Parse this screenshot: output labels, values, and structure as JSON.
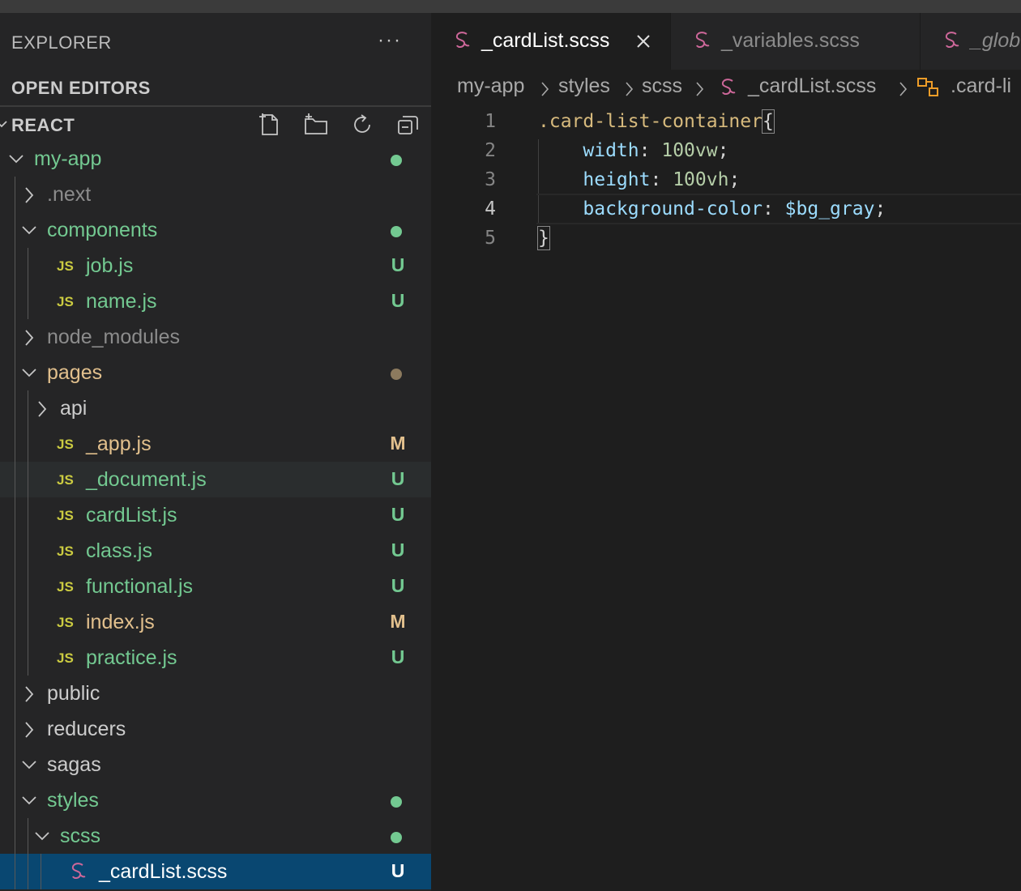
{
  "explorer": {
    "title": "EXPLORER",
    "more_label": "···",
    "open_editors_label": "OPEN EDITORS",
    "workspace_label": "REACT"
  },
  "tree": [
    {
      "name": "my-app",
      "type": "folder",
      "expanded": true,
      "depth": 0,
      "color": "#73c991",
      "status": "dot",
      "dot_color": "#73c991"
    },
    {
      "name": ".next",
      "type": "folder",
      "expanded": false,
      "depth": 1,
      "color": "#8c8c8c"
    },
    {
      "name": "components",
      "type": "folder",
      "expanded": true,
      "depth": 1,
      "color": "#73c991",
      "status": "dot",
      "dot_color": "#73c991"
    },
    {
      "name": "job.js",
      "type": "js",
      "depth": 2,
      "color": "#73c991",
      "status": "U",
      "status_color": "#73c991"
    },
    {
      "name": "name.js",
      "type": "js",
      "depth": 2,
      "color": "#73c991",
      "status": "U",
      "status_color": "#73c991"
    },
    {
      "name": "node_modules",
      "type": "folder",
      "expanded": false,
      "depth": 1,
      "color": "#8c8c8c"
    },
    {
      "name": "pages",
      "type": "folder",
      "expanded": true,
      "depth": 1,
      "color": "#e2c08d",
      "status": "dot",
      "dot_color": "#8c7a5e"
    },
    {
      "name": "api",
      "type": "folder",
      "expanded": false,
      "depth": 2,
      "color": "#cccccc"
    },
    {
      "name": "_app.js",
      "type": "js",
      "depth": 2,
      "color": "#e2c08d",
      "status": "M",
      "status_color": "#e2c08d"
    },
    {
      "name": "_document.js",
      "type": "js",
      "depth": 2,
      "color": "#73c991",
      "status": "U",
      "status_color": "#73c991",
      "hover": true
    },
    {
      "name": "cardList.js",
      "type": "js",
      "depth": 2,
      "color": "#73c991",
      "status": "U",
      "status_color": "#73c991"
    },
    {
      "name": "class.js",
      "type": "js",
      "depth": 2,
      "color": "#73c991",
      "status": "U",
      "status_color": "#73c991"
    },
    {
      "name": "functional.js",
      "type": "js",
      "depth": 2,
      "color": "#73c991",
      "status": "U",
      "status_color": "#73c991"
    },
    {
      "name": "index.js",
      "type": "js",
      "depth": 2,
      "color": "#e2c08d",
      "status": "M",
      "status_color": "#e2c08d"
    },
    {
      "name": "practice.js",
      "type": "js",
      "depth": 2,
      "color": "#73c991",
      "status": "U",
      "status_color": "#73c991"
    },
    {
      "name": "public",
      "type": "folder",
      "expanded": false,
      "depth": 1,
      "color": "#cccccc"
    },
    {
      "name": "reducers",
      "type": "folder",
      "expanded": false,
      "depth": 1,
      "color": "#cccccc"
    },
    {
      "name": "sagas",
      "type": "folder",
      "expanded": true,
      "depth": 1,
      "color": "#cccccc"
    },
    {
      "name": "styles",
      "type": "folder",
      "expanded": true,
      "depth": 1,
      "color": "#73c991",
      "status": "dot",
      "dot_color": "#73c991"
    },
    {
      "name": "scss",
      "type": "folder",
      "expanded": true,
      "depth": 2,
      "color": "#73c991",
      "status": "dot",
      "dot_color": "#73c991"
    },
    {
      "name": "_cardList.scss",
      "type": "scss",
      "depth": 3,
      "color": "#ffffff",
      "status": "U",
      "status_color": "#ffffff",
      "selected": true
    }
  ],
  "tabs": [
    {
      "label": "_cardList.scss",
      "active": true
    },
    {
      "label": "_variables.scss",
      "active": false
    },
    {
      "label": "_glob",
      "active": false
    }
  ],
  "breadcrumb": {
    "items": [
      "my-app",
      "styles",
      "scss",
      "_cardList.scss",
      ".card-li"
    ]
  },
  "code": {
    "line_numbers": [
      "1",
      "2",
      "3",
      "4",
      "5"
    ],
    "active_line": 4,
    "selector": ".card-list-container",
    "open_brace": "{",
    "close_brace": "}",
    "props": [
      {
        "name": "width",
        "value": "100vw"
      },
      {
        "name": "height",
        "value": "100vh"
      },
      {
        "name": "background-color",
        "value": "$bg_gray"
      }
    ],
    "colon": ": ",
    "semicolon": ";"
  },
  "colors": {
    "scss_icon": "#cd6799",
    "js_icon": "#cbcb41",
    "selection": "#094771",
    "symbol_icon": "#ee9d28"
  }
}
